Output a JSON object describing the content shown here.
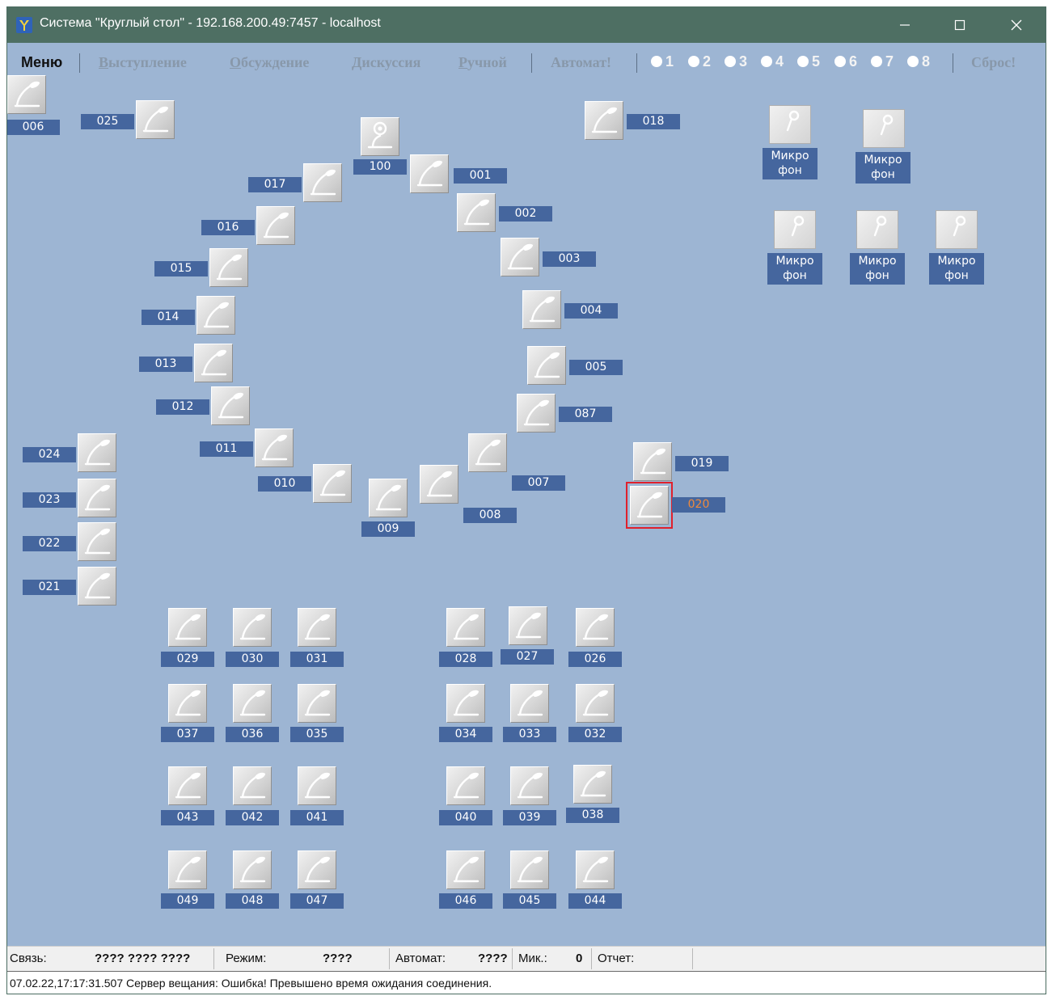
{
  "window": {
    "title": "Система \"Круглый стол\" - 192.168.200.49:7457 - localhost"
  },
  "menubar": {
    "menu": "Меню",
    "items": [
      {
        "first": "В",
        "rest": "ыступление"
      },
      {
        "first": "О",
        "rest": "бсуждение"
      },
      {
        "first": "Д",
        "rest": "искуссия"
      },
      {
        "first": "Р",
        "rest": "учной"
      }
    ],
    "auto": "Автомат!",
    "reset": "Сброс!",
    "radios": [
      "1",
      "2",
      "3",
      "4",
      "5",
      "6",
      "7",
      "8"
    ]
  },
  "seats": [
    {
      "label": "006"
    },
    {
      "label": "025"
    },
    {
      "label": "018"
    },
    {
      "label": "100"
    },
    {
      "label": "017"
    },
    {
      "label": "001"
    },
    {
      "label": "016"
    },
    {
      "label": "002"
    },
    {
      "label": "015"
    },
    {
      "label": "003"
    },
    {
      "label": "014"
    },
    {
      "label": "004"
    },
    {
      "label": "013"
    },
    {
      "label": "005"
    },
    {
      "label": "012"
    },
    {
      "label": "087"
    },
    {
      "label": "024"
    },
    {
      "label": "011"
    },
    {
      "label": "019"
    },
    {
      "label": "010"
    },
    {
      "label": "007"
    },
    {
      "label": "023"
    },
    {
      "label": "020",
      "selected": true
    },
    {
      "label": "009"
    },
    {
      "label": "008"
    },
    {
      "label": "022"
    },
    {
      "label": "021"
    },
    {
      "label": "029"
    },
    {
      "label": "030"
    },
    {
      "label": "031"
    },
    {
      "label": "028"
    },
    {
      "label": "027"
    },
    {
      "label": "026"
    },
    {
      "label": "037"
    },
    {
      "label": "036"
    },
    {
      "label": "035"
    },
    {
      "label": "034"
    },
    {
      "label": "033"
    },
    {
      "label": "032"
    },
    {
      "label": "043"
    },
    {
      "label": "042"
    },
    {
      "label": "041"
    },
    {
      "label": "040"
    },
    {
      "label": "039"
    },
    {
      "label": "038"
    },
    {
      "label": "049"
    },
    {
      "label": "048"
    },
    {
      "label": "047"
    },
    {
      "label": "046"
    },
    {
      "label": "045"
    },
    {
      "label": "044"
    }
  ],
  "microphones": [
    {
      "line1": "Микро",
      "line2": "фон"
    },
    {
      "line1": "Микро",
      "line2": "фон"
    },
    {
      "line1": "Микро",
      "line2": "фон"
    },
    {
      "line1": "Микро",
      "line2": "фон"
    },
    {
      "line1": "Микро",
      "line2": "фон"
    }
  ],
  "statusbar": {
    "link_label": "Связь:",
    "link_value": "????  ????  ????",
    "mode_label": "Режим:",
    "mode_value": "????",
    "auto_label": "Автомат:",
    "auto_value": "????",
    "mic_label": "Мик.:",
    "mic_value": "0",
    "report_label": "Отчет:"
  },
  "log": {
    "message": "07.02.22,17:17:31.507 Сервер вещания: Ошибка!  Превышено время ожидания соединения."
  },
  "colors": {
    "titlebar": "#4e6f63",
    "canvas": "#9db5d3",
    "label_bg": "#45669e",
    "warn_label": "#f08a3c",
    "selection": "#e0202c"
  }
}
